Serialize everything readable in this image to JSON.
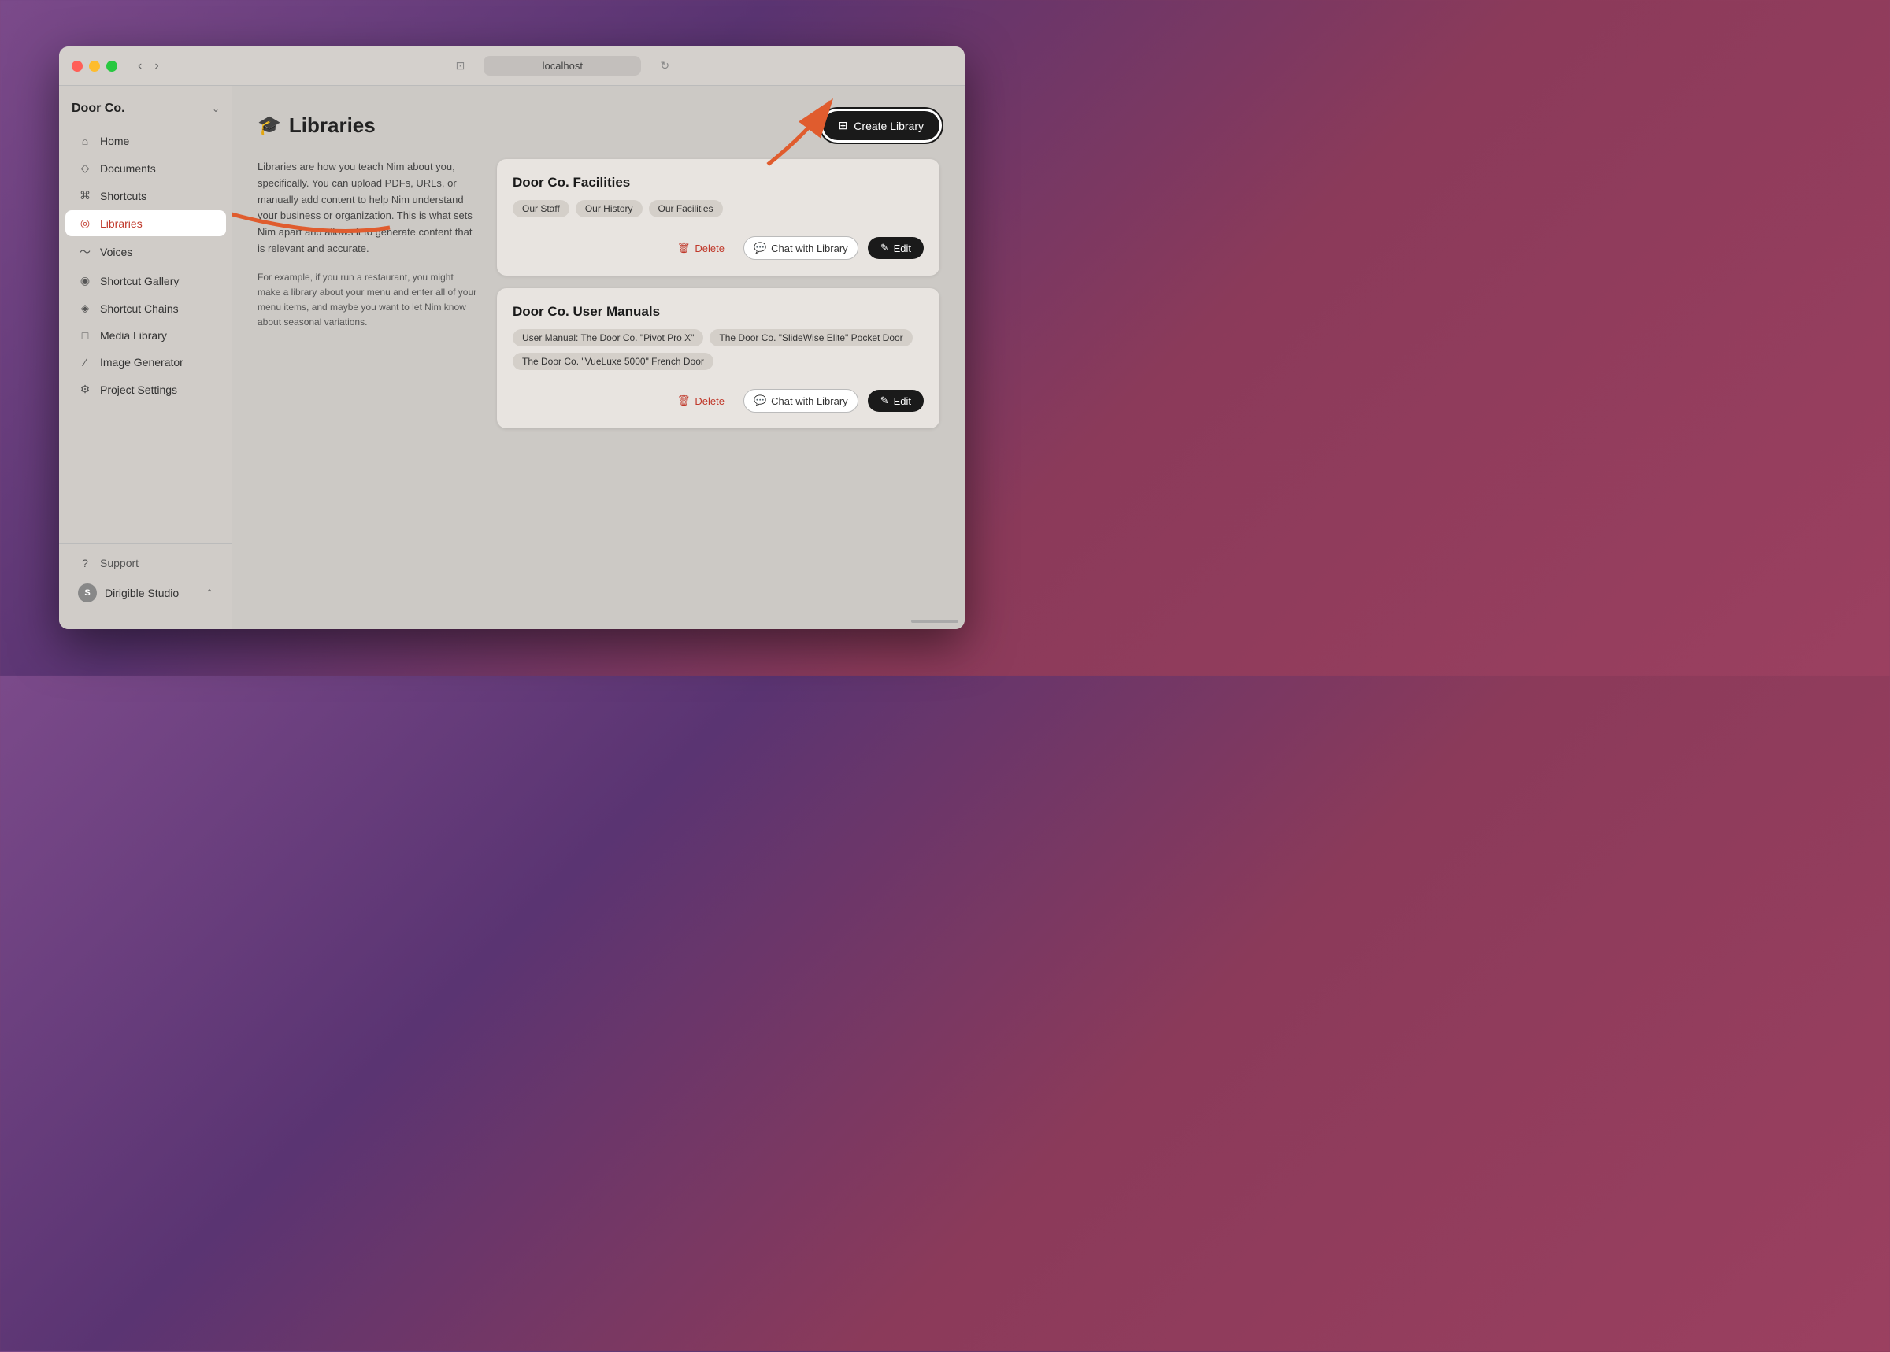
{
  "window": {
    "url": "localhost",
    "title": "Libraries"
  },
  "sidebar": {
    "workspace": "Door Co.",
    "workspace_chevron": "⌄",
    "items": [
      {
        "id": "home",
        "label": "Home",
        "icon": "⌂",
        "active": false
      },
      {
        "id": "documents",
        "label": "Documents",
        "icon": "◇",
        "active": false
      },
      {
        "id": "shortcuts",
        "label": "Shortcuts",
        "icon": "⌘",
        "active": false
      },
      {
        "id": "libraries",
        "label": "Libraries",
        "icon": "◎",
        "active": true
      },
      {
        "id": "voices",
        "label": "Voices",
        "icon": "〜",
        "active": false
      },
      {
        "id": "shortcut-gallery",
        "label": "Shortcut Gallery",
        "icon": "◉",
        "active": false
      },
      {
        "id": "shortcut-chains",
        "label": "Shortcut Chains",
        "icon": "◈",
        "active": false
      },
      {
        "id": "media-library",
        "label": "Media Library",
        "icon": "□",
        "active": false
      },
      {
        "id": "image-generator",
        "label": "Image Generator",
        "icon": "∕",
        "active": false
      },
      {
        "id": "project-settings",
        "label": "Project Settings",
        "icon": "◎",
        "active": false
      }
    ],
    "support_label": "Support",
    "workspace_name": "Dirigible Studio",
    "workspace_initial": "S"
  },
  "main": {
    "page_icon": "🎓",
    "page_title": "Libraries",
    "create_button_label": "Create Library",
    "description": {
      "main_text": "Libraries are how you teach Nim about you, specifically. You can upload PDFs, URLs, or manually add content to help Nim understand your business or organization. This is what sets Nim apart and allows it to generate content that is relevant and accurate.",
      "example_text": "For example, if you run a restaurant, you might make a library about your menu and enter all of your menu items, and maybe you want to let Nim know about seasonal variations."
    },
    "libraries": [
      {
        "id": "facilities",
        "title": "Door Co. Facilities",
        "tags": [
          "Our Staff",
          "Our History",
          "Our Facilities"
        ],
        "delete_label": "Delete",
        "chat_label": "Chat with Library",
        "edit_label": "Edit"
      },
      {
        "id": "user-manuals",
        "title": "Door Co. User Manuals",
        "tags": [
          "User Manual: The Door Co. \"Pivot Pro X\"",
          "The Door Co. \"SlideWise Elite\" Pocket Door",
          "The Door Co. \"VueLuxe 5000\" French Door"
        ],
        "delete_label": "Delete",
        "chat_label": "Chat with Library",
        "edit_label": "Edit"
      }
    ]
  }
}
